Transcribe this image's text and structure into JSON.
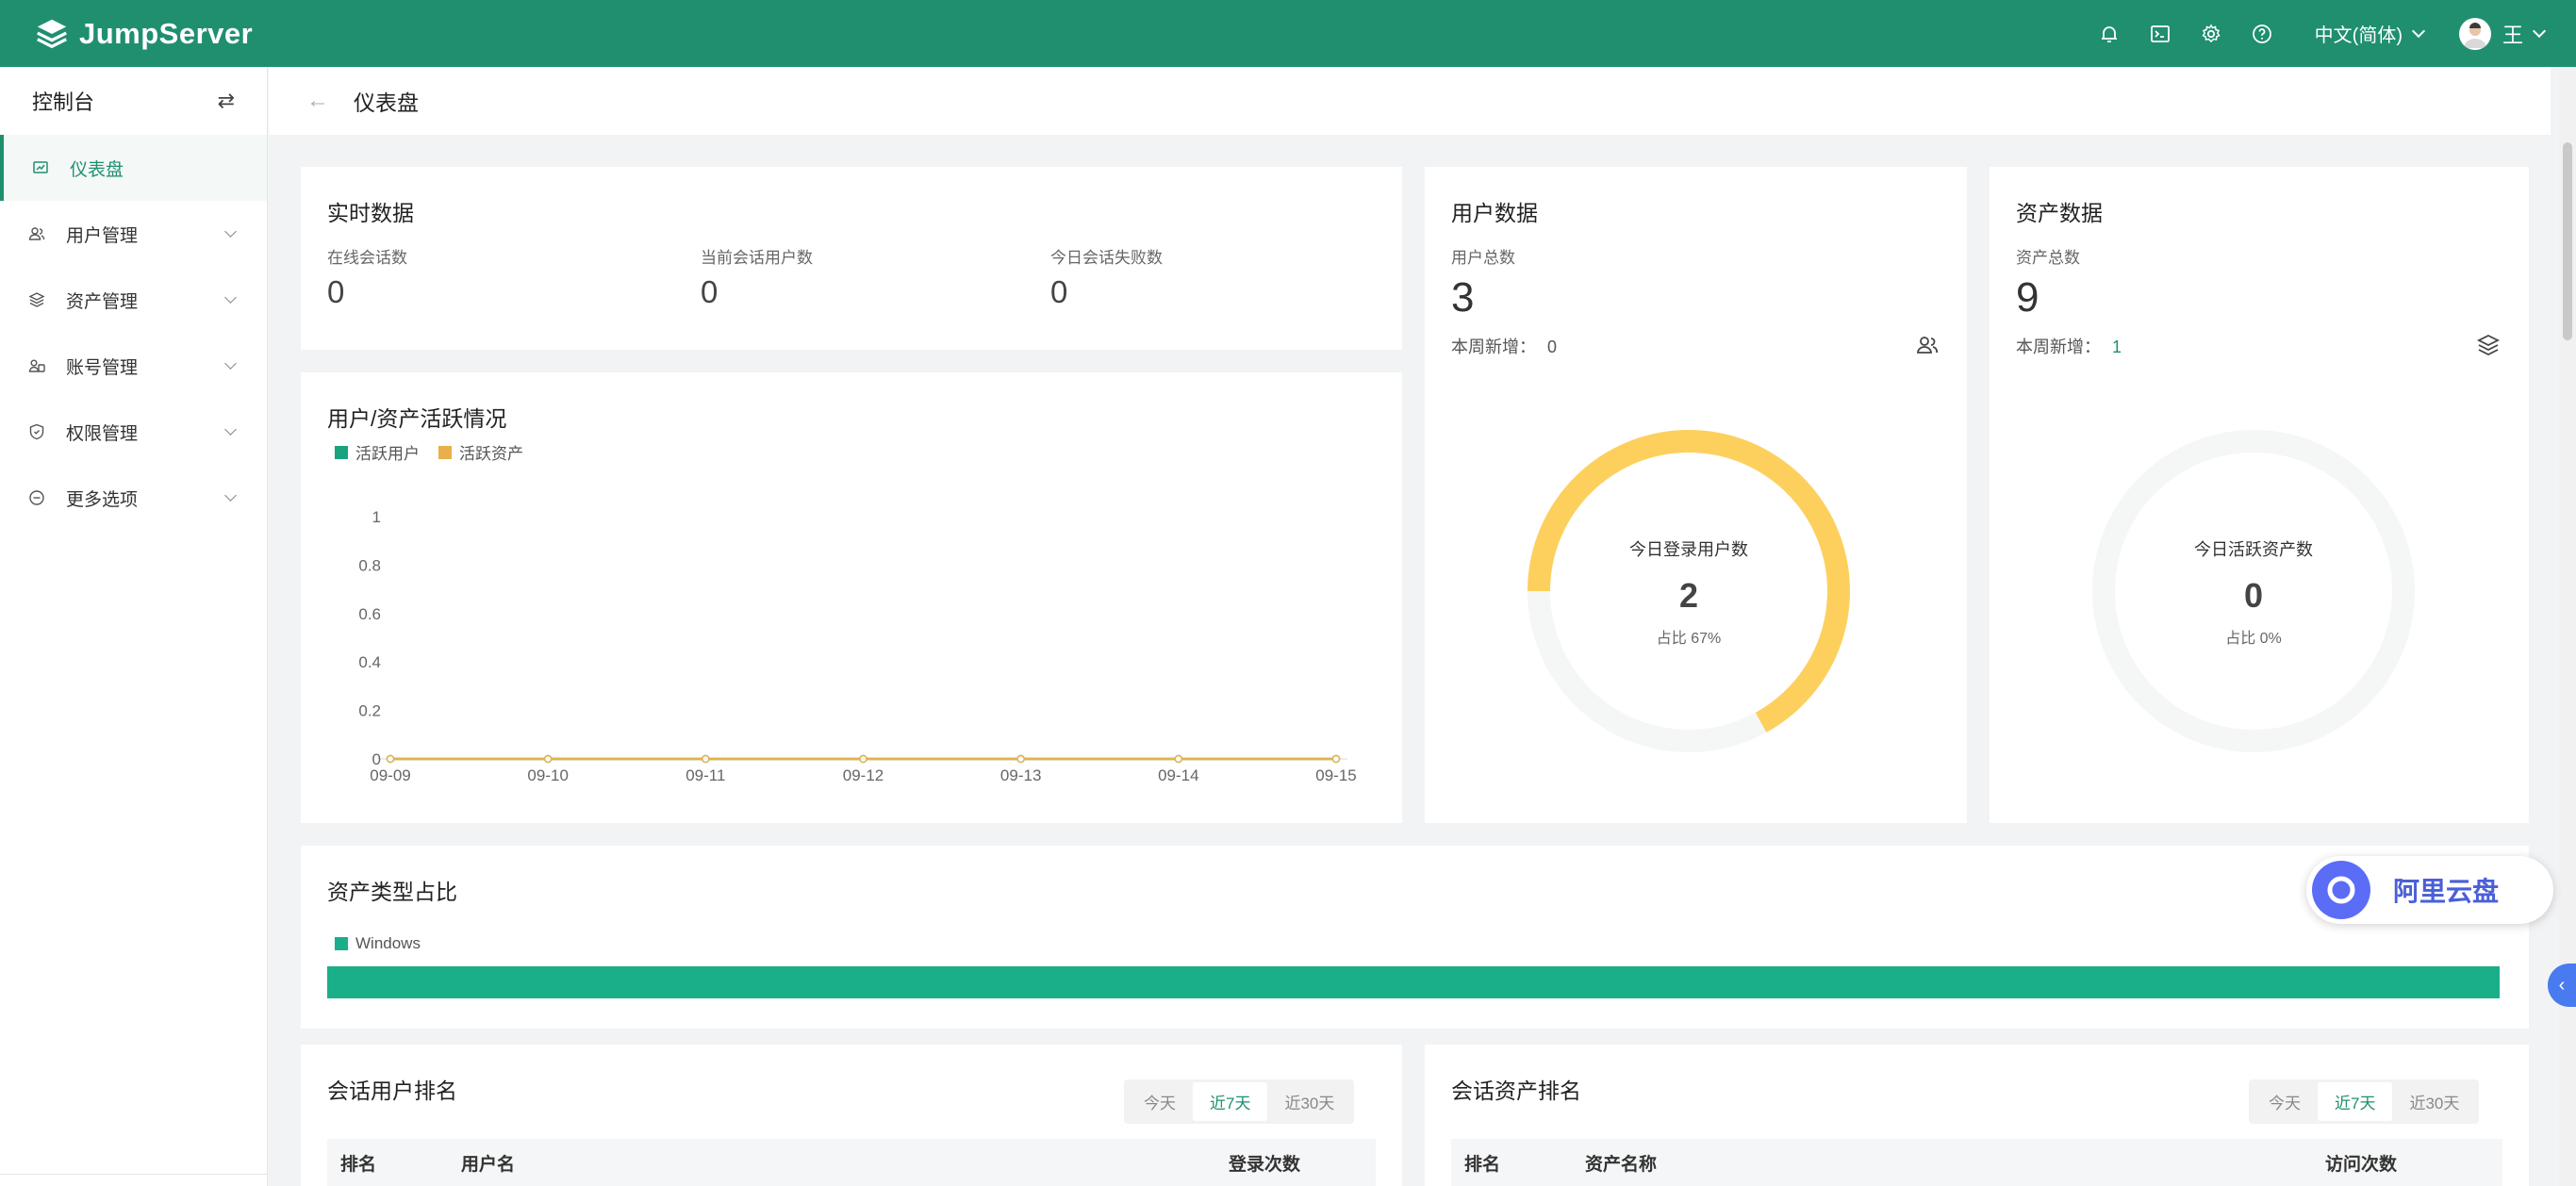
{
  "header": {
    "brand": "JumpServer",
    "language": "中文(简体)",
    "user_name": "王",
    "icons": [
      "bell-icon",
      "terminal-icon",
      "gear-icon",
      "help-icon"
    ]
  },
  "sidebar": {
    "title": "控制台",
    "swap_glyph": "⇄",
    "items": [
      {
        "label": "仪表盘",
        "icon": "dashboard-icon",
        "active": true
      },
      {
        "label": "用户管理",
        "icon": "users-icon"
      },
      {
        "label": "资产管理",
        "icon": "stack-icon"
      },
      {
        "label": "账号管理",
        "icon": "account-icon"
      },
      {
        "label": "权限管理",
        "icon": "shield-icon"
      },
      {
        "label": "更多选项",
        "icon": "more-icon"
      }
    ]
  },
  "page": {
    "back_glyph": "←",
    "title": "仪表盘"
  },
  "realtime": {
    "title": "实时数据",
    "stats": [
      {
        "label": "在线会话数",
        "value": "0"
      },
      {
        "label": "当前会话用户数",
        "value": "0"
      },
      {
        "label": "今日会话失败数",
        "value": "0"
      }
    ]
  },
  "user_data": {
    "title": "用户数据",
    "total_label": "用户总数",
    "total_value": "3",
    "weekly_label": "本周新增：",
    "weekly_value": "0",
    "donut_label": "今日登录用户数",
    "donut_value": "2",
    "donut_pct": "占比 67%",
    "donut_fraction": 0.67,
    "donut_color": "#fdd05e"
  },
  "asset_data": {
    "title": "资产数据",
    "total_label": "资产总数",
    "total_value": "9",
    "weekly_label": "本周新增：",
    "weekly_value": "1",
    "donut_label": "今日活跃资产数",
    "donut_value": "0",
    "donut_pct": "占比 0%",
    "donut_fraction": 0
  },
  "activity": {
    "title": "用户/资产活跃情况"
  },
  "chart_data": {
    "type": "line",
    "x": [
      "09-09",
      "09-10",
      "09-11",
      "09-12",
      "09-13",
      "09-14",
      "09-15"
    ],
    "series": [
      {
        "name": "活跃用户",
        "color": "#1aa37e",
        "values": [
          0,
          0,
          0,
          0,
          0,
          0,
          0
        ]
      },
      {
        "name": "活跃资产",
        "color": "#e8b04a",
        "values": [
          0,
          0,
          0,
          0,
          0,
          0,
          0
        ]
      }
    ],
    "y_ticks": [
      "0",
      "0.2",
      "0.4",
      "0.6",
      "0.8",
      "1"
    ],
    "ylim": [
      0,
      1
    ],
    "legend": "top-left",
    "grid": false
  },
  "asset_types": {
    "title": "资产类型占比",
    "items": [
      {
        "name": "Windows",
        "fraction": 1.0,
        "color": "#1aaf88"
      }
    ]
  },
  "user_rank": {
    "title": "会话用户排名",
    "tabs": [
      "今天",
      "近7天",
      "近30天"
    ],
    "active_tab": 1,
    "columns": [
      "排名",
      "用户名",
      "登录次数"
    ]
  },
  "asset_rank": {
    "title": "会话资产排名",
    "tabs": [
      "今天",
      "近7天",
      "近30天"
    ],
    "active_tab": 1,
    "columns": [
      "排名",
      "资产名称",
      "访问次数"
    ]
  },
  "cloud_badge": {
    "text": "阿里云盘"
  },
  "side_tab_glyph": "‹"
}
